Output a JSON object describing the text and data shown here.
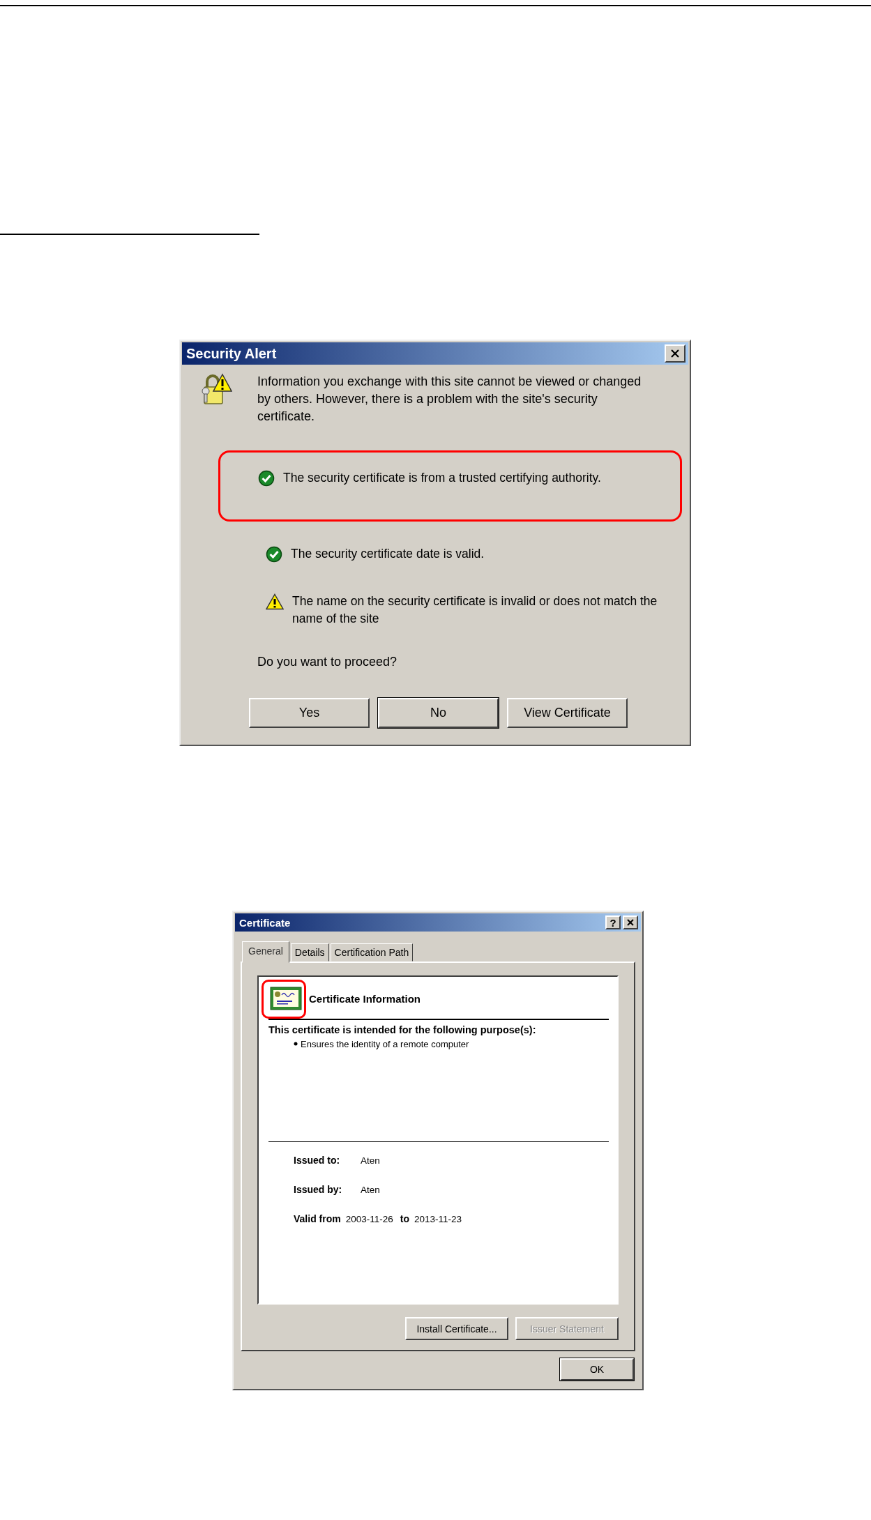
{
  "security_alert": {
    "title": "Security Alert",
    "message": "Information you exchange with this site cannot be viewed or changed by others. However, there is a problem with the site's security certificate.",
    "checks": [
      {
        "kind": "ok",
        "text": "The security certificate is from a trusted certifying authority.",
        "highlighted": true
      },
      {
        "kind": "ok",
        "text": "The security certificate date is valid.",
        "highlighted": false
      },
      {
        "kind": "warning",
        "text": "The name on the security certificate is invalid or does not match the name of the site",
        "highlighted": false
      }
    ],
    "question": "Do you want to proceed?",
    "buttons": [
      {
        "label": "Yes",
        "default": false
      },
      {
        "label": "No",
        "default": true
      },
      {
        "label": "View Certificate",
        "default": false
      }
    ]
  },
  "certificate": {
    "title": "Certificate",
    "help": "?",
    "tabs": [
      {
        "label": "General",
        "selected": true
      },
      {
        "label": "Details",
        "selected": false
      },
      {
        "label": "Certification Path",
        "selected": false
      }
    ],
    "heading": "Certificate Information",
    "heading_highlighted": true,
    "purpose_title": "This certificate is intended for the following purpose(s):",
    "purposes": [
      "Ensures the identity of a remote computer"
    ],
    "issued_to": {
      "label": "Issued to:",
      "value": "Aten"
    },
    "issued_by": {
      "label": "Issued by:",
      "value": "Aten"
    },
    "validity": {
      "from_label": "Valid from",
      "from": "2003-11-26",
      "to_label": "to",
      "to": "2013-11-23"
    },
    "buttons": [
      {
        "label": "Install Certificate...",
        "disabled": false
      },
      {
        "label": "Issuer Statement",
        "disabled": true
      }
    ],
    "ok": "OK"
  }
}
